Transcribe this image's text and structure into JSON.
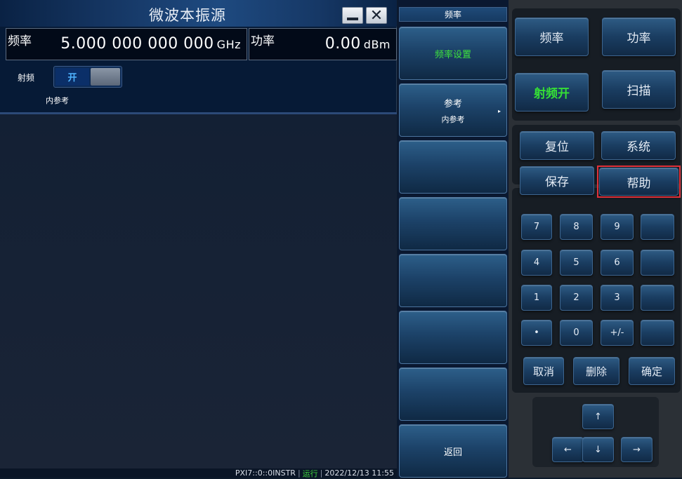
{
  "window": {
    "title": "微波本振源",
    "min_label": "",
    "close_label": "✕"
  },
  "frequency": {
    "label": "频率",
    "value": "5.000 000 000 000",
    "unit": "GHz"
  },
  "power": {
    "label": "功率",
    "value": "0.00",
    "unit": "dBm"
  },
  "rf": {
    "label": "射频",
    "state": "开"
  },
  "reference": {
    "label": "内参考"
  },
  "status_bar": {
    "resource": "PXI7::0::0INSTR",
    "sep1": "|",
    "state": "运行",
    "sep2": "|",
    "datetime": "2022/12/13 11:55"
  },
  "softkeys": {
    "title": "频率",
    "keys": [
      {
        "label": "频率设置",
        "sub": ""
      },
      {
        "label": "参考",
        "sub": "内参考",
        "arrow": "▸"
      },
      {
        "label": "",
        "sub": ""
      },
      {
        "label": "",
        "sub": ""
      },
      {
        "label": "",
        "sub": ""
      },
      {
        "label": "",
        "sub": ""
      },
      {
        "label": "",
        "sub": ""
      },
      {
        "label": "返回",
        "sub": ""
      }
    ]
  },
  "hw_panel": {
    "function_keys": {
      "freq": "频率",
      "power": "功率",
      "rf_on": "射频开",
      "sweep": "扫描"
    },
    "system_keys": {
      "reset": "复位",
      "system": "系统",
      "save": "保存",
      "help": "帮助"
    },
    "keypad": {
      "rows": [
        [
          "7",
          "8",
          "9",
          ""
        ],
        [
          "4",
          "5",
          "6",
          ""
        ],
        [
          "1",
          "2",
          "3",
          ""
        ],
        [
          "•",
          "0",
          "+/-",
          ""
        ]
      ],
      "cancel": "取消",
      "delete": "删除",
      "confirm": "确定"
    },
    "arrows": {
      "up": "↑",
      "left": "←",
      "down": "↓",
      "right": "→"
    }
  },
  "colors": {
    "accent_green": "#35df35",
    "rf_on_blue": "#4fb4ff",
    "highlight_red": "#e0313a"
  }
}
